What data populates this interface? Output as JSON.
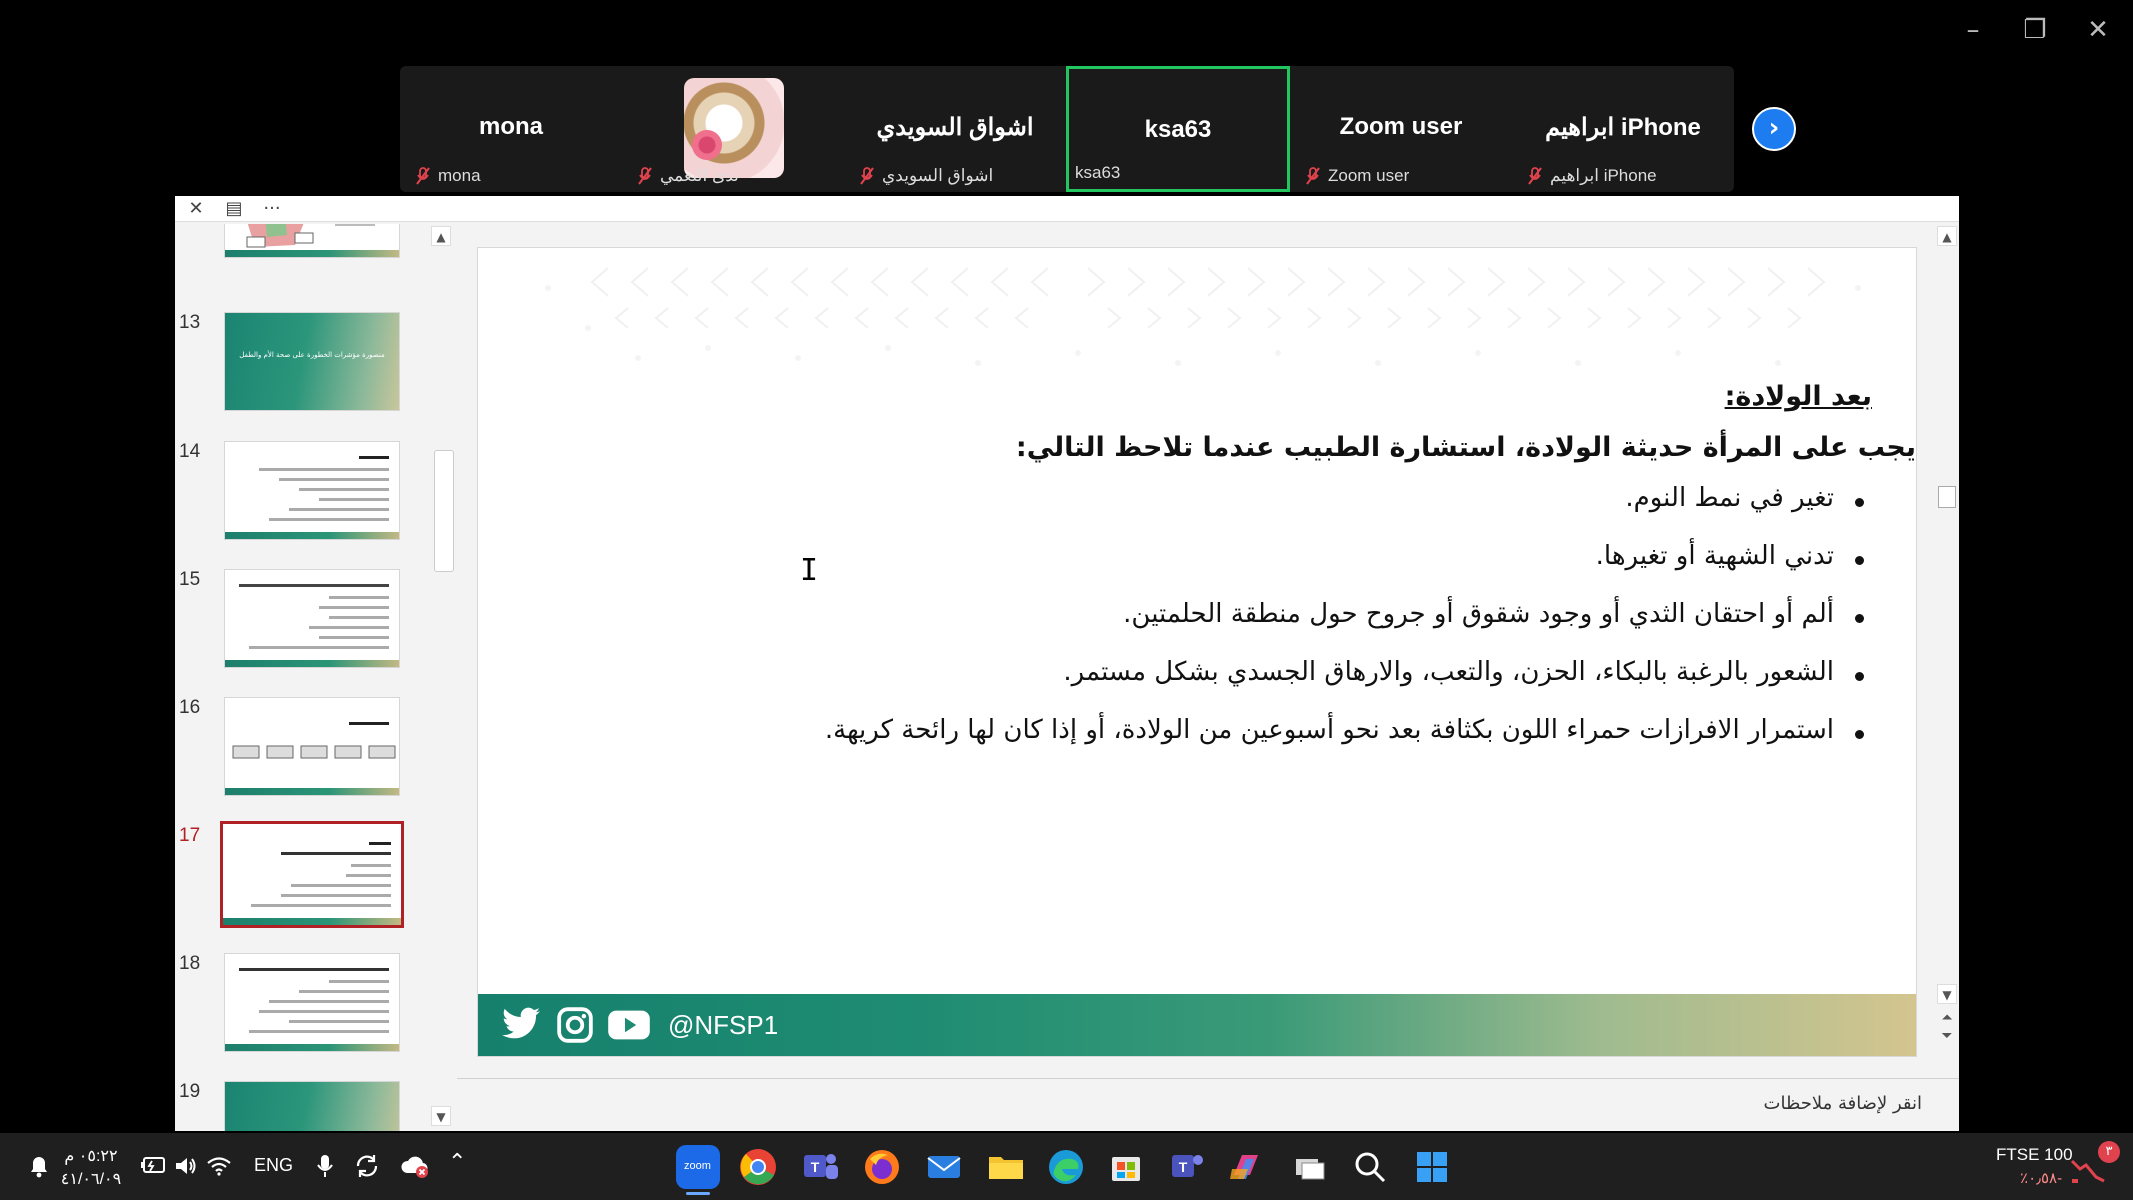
{
  "participants": [
    {
      "display": "mona",
      "label": "mona"
    },
    {
      "display": "",
      "label": "ندى النعمي"
    },
    {
      "display": "اشواق السويدي",
      "label": "اشواق السويدي"
    },
    {
      "display": "ksa63",
      "label": "ksa63"
    },
    {
      "display": "Zoom user",
      "label": "Zoom user"
    },
    {
      "display": "ابراهيم iPhone",
      "label": "ابراهيم iPhone"
    }
  ],
  "thumbnails": [
    "13",
    "14",
    "15",
    "16",
    "17",
    "18",
    "19"
  ],
  "thumb_title_13": "منصورة\nمؤشرات الخطورة على صحة الأم والطفل",
  "slide": {
    "heading": "بعد الولادة:",
    "subheading": "يجب على المرأة حديثة الولادة، استشارة الطبيب عندما تلاحظ التالي:",
    "bullets": [
      "تغير في نمط النوم.",
      "تدني الشهية أو تغيرها.",
      "ألم أو احتقان الثدي أو وجود شقوق أو جروح حول منطقة الحلمتين.",
      "الشعور بالرغبة بالبكاء، الحزن، والتعب، والارهاق الجسدي بشكل مستمر.",
      "استمرار الافرازات حمراء اللون بكثافة بعد نحو أسبوعين من الولادة، أو إذا كان لها رائحة كريهة."
    ],
    "handle": "@NFSP1"
  },
  "notes_placeholder": "انقر لإضافة ملاحظات",
  "taskbar": {
    "time": "٠٥:٢٢ م",
    "date": "٤١/٠٦/٠٩",
    "lang": "ENG",
    "stock_name": "FTSE 100",
    "stock_change": "٪٠٫٥٨-",
    "notif_count": "٣"
  },
  "colors": {
    "active_border": "#22c55e",
    "accent_blue": "#1c7cf0",
    "selection_red": "#b12025",
    "footer_green": "#16806d"
  }
}
